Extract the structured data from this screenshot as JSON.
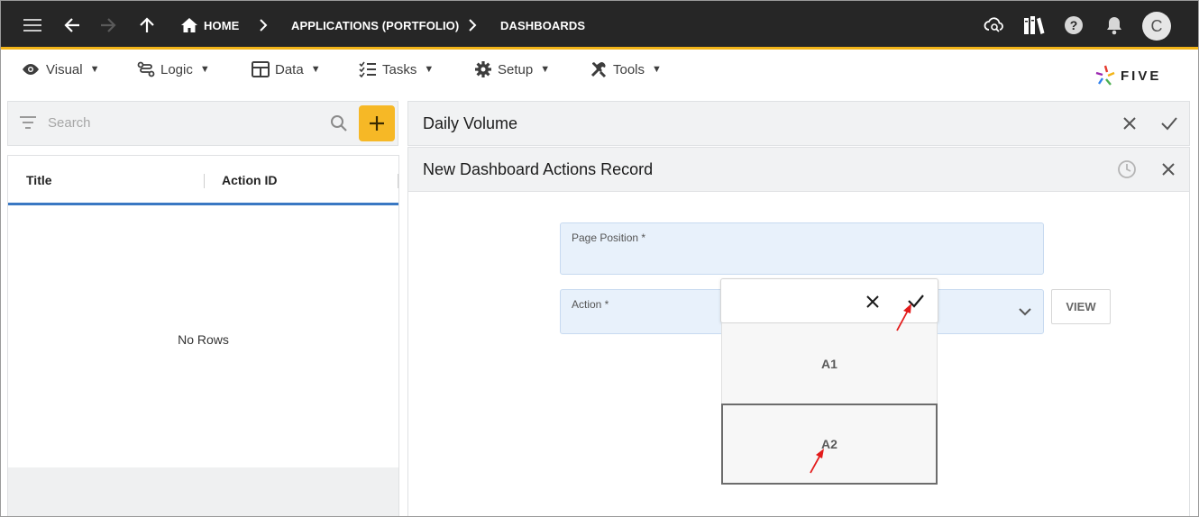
{
  "topbar": {
    "breadcrumbs": [
      {
        "label": "HOME"
      },
      {
        "label": "APPLICATIONS (PORTFOLIO)"
      },
      {
        "label": "DASHBOARDS"
      }
    ],
    "avatar_initial": "C"
  },
  "menu": {
    "items": [
      {
        "label": "Visual",
        "icon": "eye-icon"
      },
      {
        "label": "Logic",
        "icon": "logic-icon"
      },
      {
        "label": "Data",
        "icon": "table-icon"
      },
      {
        "label": "Tasks",
        "icon": "checklist-icon"
      },
      {
        "label": "Setup",
        "icon": "gear-icon"
      },
      {
        "label": "Tools",
        "icon": "tools-icon"
      }
    ],
    "caret": "▼",
    "logo_text": "FIVE"
  },
  "list": {
    "search_placeholder": "Search",
    "columns": [
      "Title",
      "Action ID"
    ],
    "empty_text": "No Rows"
  },
  "parent_panel": {
    "title": "Daily Volume"
  },
  "form_panel": {
    "title": "New Dashboard Actions Record"
  },
  "form": {
    "page_position_label": "Page Position *",
    "page_position_value": "",
    "action_label": "Action *",
    "view_button": "VIEW"
  },
  "dropdown": {
    "filter_value": "",
    "options": [
      "A1",
      "A2"
    ],
    "highlighted": "A2"
  },
  "colors": {
    "topbar_bg": "#262626",
    "accent": "#f2b418",
    "field_bg": "#e8f1fb",
    "header_underline": "#3a78c3",
    "annotation_arrow": "#e31b1b"
  }
}
